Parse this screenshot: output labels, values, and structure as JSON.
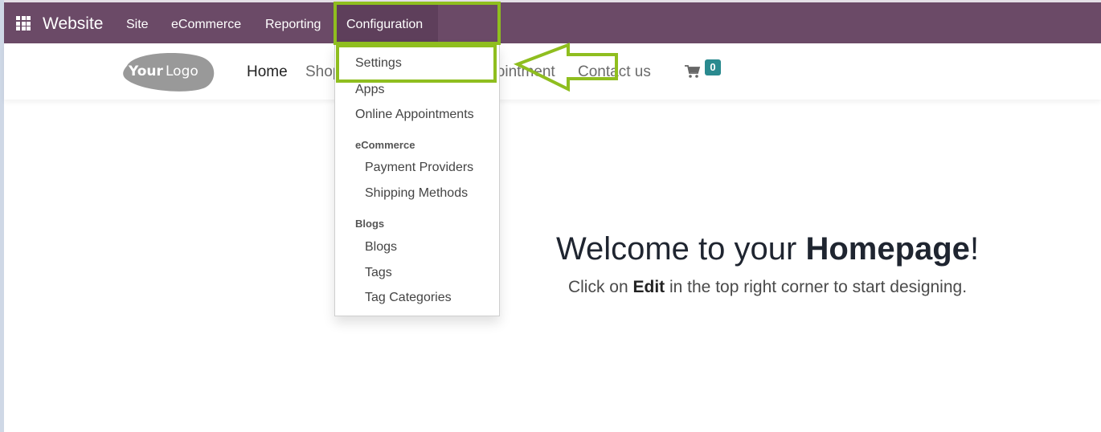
{
  "topbar": {
    "app_icon": "apps-grid-icon",
    "app_title": "Website",
    "menu": [
      "Site",
      "eCommerce",
      "Reporting",
      "Configuration"
    ],
    "active_menu": "Configuration",
    "bg_color": "#6b4a67"
  },
  "site_header": {
    "logo": {
      "bold": "Your",
      "light": "Logo"
    },
    "nav": [
      "Home",
      "Shop",
      "Appointment",
      "Contact us"
    ],
    "active_nav": "Home",
    "cart_icon": "shopping-cart-icon",
    "cart_count": "0",
    "badge_color": "#2a8a8f"
  },
  "dropdown": {
    "items_top": [
      "Settings",
      "Apps",
      "Online Appointments"
    ],
    "sections": [
      {
        "header": "eCommerce",
        "items": [
          "Payment Providers",
          "Shipping Methods"
        ]
      },
      {
        "header": "Blogs",
        "items": [
          "Blogs",
          "Tags",
          "Tag Categories"
        ]
      }
    ]
  },
  "hero": {
    "title_prefix": "Welcome to your ",
    "title_bold": "Homepage",
    "title_suffix": "!",
    "sub_prefix": "Click on ",
    "sub_bold": "Edit",
    "sub_suffix": " in the top right corner to start designing."
  },
  "annotation": {
    "color": "#8fbe1f",
    "arrow_icon": "left-arrow-annotation-icon"
  }
}
